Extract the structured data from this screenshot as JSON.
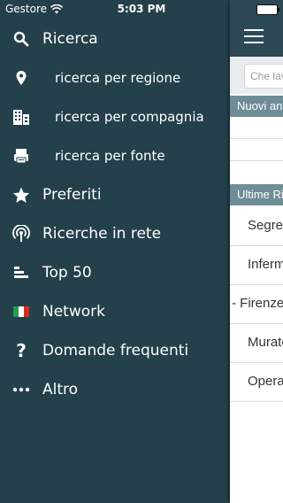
{
  "status_bar": {
    "carrier": "Gestore",
    "time": "5:03 PM"
  },
  "menu": {
    "items": [
      {
        "label": "Ricerca",
        "icon": "search-icon"
      },
      {
        "label": "ricerca per regione",
        "icon": "location-pin-icon"
      },
      {
        "label": "ricerca per compagnia",
        "icon": "buildings-icon"
      },
      {
        "label": "ricerca per fonte",
        "icon": "printer-icon"
      },
      {
        "label": "Preferiti",
        "icon": "star-icon"
      },
      {
        "label": "Ricerche in rete",
        "icon": "broadcast-icon"
      },
      {
        "label": "Top 50",
        "icon": "bar-chart-icon"
      },
      {
        "label": "Network",
        "icon": "italy-flag-icon"
      },
      {
        "label": "Domande frequenti",
        "icon": "question-icon"
      },
      {
        "label": "Altro",
        "icon": "more-dots-icon"
      }
    ]
  },
  "content": {
    "search_placeholder": "Che lavoro",
    "sections": {
      "new_ads": "Nuovi annunci",
      "recent_searches": "Ultime Ricerche"
    },
    "recent_rows": [
      "Segretaria",
      "Infermiere",
      "- Firenze",
      "Muratore",
      "Operaio"
    ]
  },
  "colors": {
    "menu_bg": "#24404b",
    "navbar_bg": "#2c4955",
    "section_bg": "#6e8d96"
  }
}
